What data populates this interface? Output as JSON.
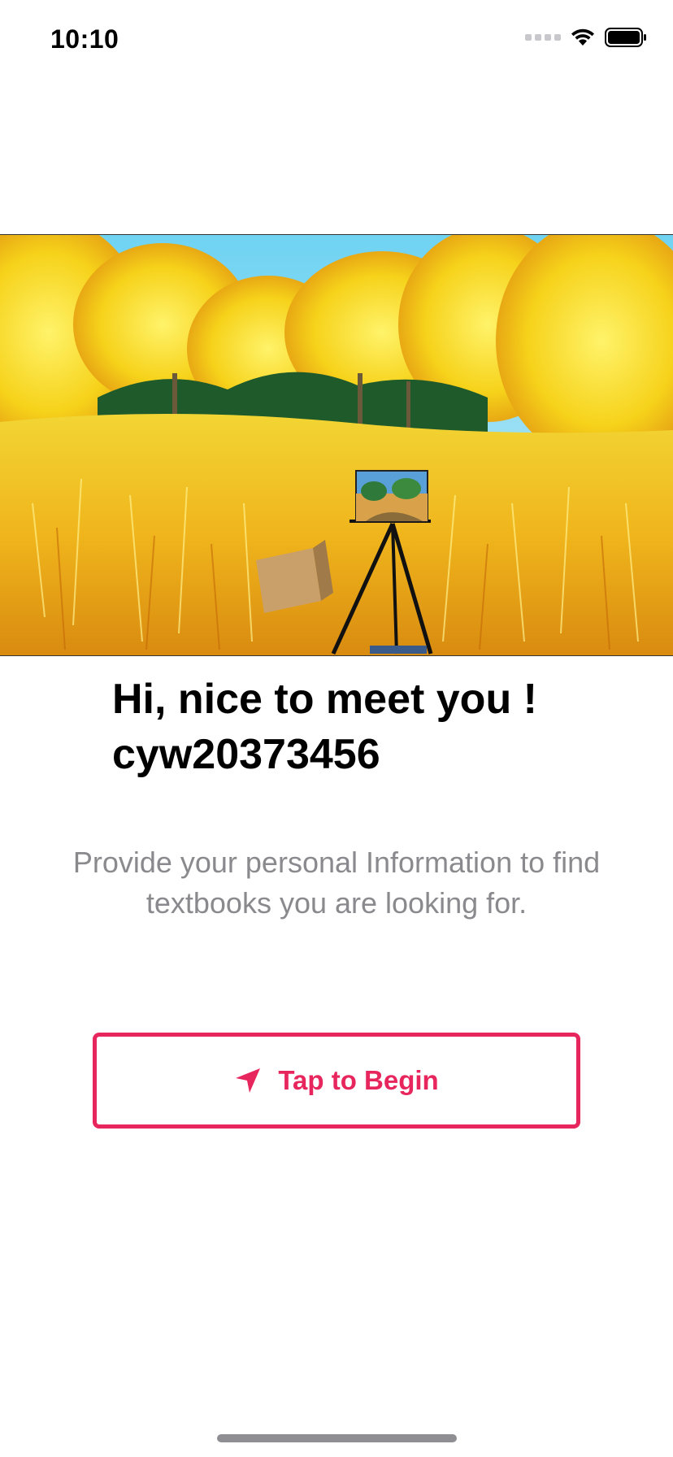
{
  "status_bar": {
    "time": "10:10",
    "icons": [
      "cellular-signal-icon",
      "wifi-icon",
      "battery-icon"
    ]
  },
  "hero": {
    "image": "autumn-park-easel-painting"
  },
  "greeting": {
    "line1": "Hi, nice to meet you !",
    "username": "cyw20373456"
  },
  "subtitle": {
    "line1": "Provide your personal Information to find",
    "line2": "textbooks you are looking for."
  },
  "begin_button": {
    "label": "Tap to Begin",
    "icon": "location-arrow-icon"
  },
  "colors": {
    "accent": "#e8265e",
    "subtitle_text": "#8a8a8e"
  }
}
